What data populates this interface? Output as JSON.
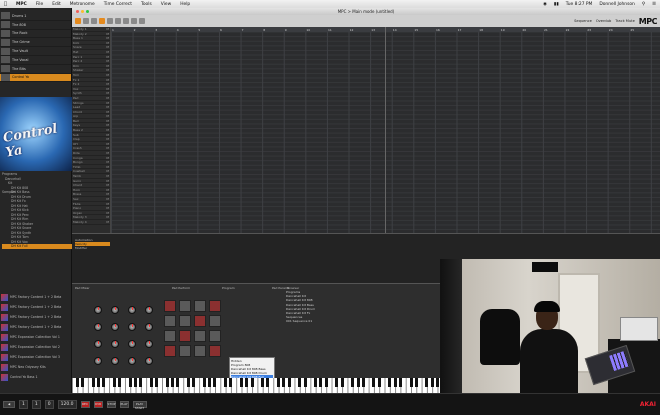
{
  "menubar": {
    "app": "MPC",
    "items": [
      "File",
      "Edit",
      "Metronome",
      "Time Correct",
      "Tools",
      "View",
      "Help"
    ],
    "clock": "Tue 8:27 PM",
    "user": "Donnell Johnson"
  },
  "window": {
    "title": "MPC > Main mode (untitled)"
  },
  "toolbar": {
    "logo": "MPC",
    "fields": [
      "Sequence",
      "Overdub",
      "Track Mute"
    ]
  },
  "browser": {
    "items": [
      {
        "name": "Drums 1",
        "sub": ""
      },
      {
        "name": "The 808",
        "sub": ""
      },
      {
        "name": "The Rock",
        "sub": ""
      },
      {
        "name": "The Grime",
        "sub": ""
      },
      {
        "name": "The Vault",
        "sub": ""
      },
      {
        "name": "The Vocal",
        "sub": ""
      },
      {
        "name": "The Bits",
        "sub": ""
      },
      {
        "name": "Control Ya",
        "sub": ""
      }
    ],
    "cover_title": "Control Ya",
    "tree": {
      "root": "Programs",
      "folder": "Dancehall",
      "sub": "Kit",
      "files": [
        "DH Kit 808",
        "DH Kit Bass",
        "DH Kit Drum",
        "DH Kit Fx",
        "DH Kit Hat",
        "DH Kit Kick",
        "DH Kit Perc",
        "DH Kit Rim",
        "DH Kit Shaker",
        "DH Kit Snare",
        "DH Kit Synth",
        "DH Kit Tom",
        "DH Kit Vox",
        "DH Kit Full"
      ],
      "selected": "DH Kit Full",
      "samples": "Samples"
    },
    "kits": [
      "MPC Factory Content 1 + 2 Beta",
      "MPC Factory Content 1 + 2 Beta",
      "MPC Factory Content 1 + 2 Beta",
      "MPC Factory Content 1 + 2 Beta",
      "MPC Expansion Collection Vol 1",
      "MPC Expansion Collection Vol 2",
      "MPC Expansion Collection Vol 3",
      "MPC Neo Odyssey Kits",
      "Control Ya Bass 1"
    ]
  },
  "tracks": {
    "names": [
      "Melody 1",
      "Melody 2",
      "Bass 1",
      "Kick",
      "Snare",
      "Hat",
      "Perc 1",
      "Perc 2",
      "Rim",
      "Shaker",
      "Tom",
      "Fx 1",
      "Fx 2",
      "Vox",
      "Synth",
      "Pad",
      "Strings",
      "Lead",
      "Chord",
      "Arp",
      "Bell",
      "Keys",
      "Bass 2",
      "Sub",
      "Clap",
      "OH",
      "Crash",
      "Ride",
      "Conga",
      "Bongo",
      "Timb",
      "Cowbell",
      "Tamb",
      "Guiro",
      "Chant",
      "Horn",
      "Brass",
      "Sax",
      "Flute",
      "Piano",
      "Organ",
      "Melody 3",
      "Melody 4"
    ],
    "bars": [
      "1",
      "2",
      "3",
      "4",
      "5",
      "6",
      "7",
      "8",
      "9",
      "10",
      "11",
      "12",
      "13",
      "14",
      "15",
      "16",
      "17",
      "18",
      "19",
      "20",
      "21",
      "22",
      "23",
      "24",
      "25"
    ]
  },
  "lower": {
    "labels": [
      "Automation",
      "Velocity",
      "Modifier"
    ],
    "selected": "Velocity"
  },
  "panels": {
    "headers": [
      "Pad Mixer",
      "Pad Perform",
      "Program",
      "Pad Params",
      "Browser"
    ],
    "program_list": [
      "Programs",
      "Dancehall Kit",
      "Dancehall Kit 808",
      "Dancehall Kit Bass",
      "Dancehall Kit Drum",
      "Dancehall Kit Fx",
      "Sequences",
      "001 Sequence 01"
    ]
  },
  "popup": {
    "items": [
      "Hidden",
      "Program 808",
      "Dancehall Kit 808 Bass",
      "Dancehall Kit 808 Drum",
      "Dancehall Kit 808 Full",
      "Dancehall Kit 808 Synth",
      "Dancehall Kit 808 Vox"
    ],
    "highlight": "Dancehall Kit 808 Full"
  },
  "transport": {
    "position": [
      "1",
      "1",
      "0"
    ],
    "bpm": "120.0",
    "buttons": [
      "REC",
      "OVR",
      "STOP",
      "PLAY",
      "PLAY START"
    ],
    "brand": "AKAI"
  },
  "colors": {
    "accent": "#d98a1e",
    "record": "#b22222",
    "brand": "#e02233"
  }
}
